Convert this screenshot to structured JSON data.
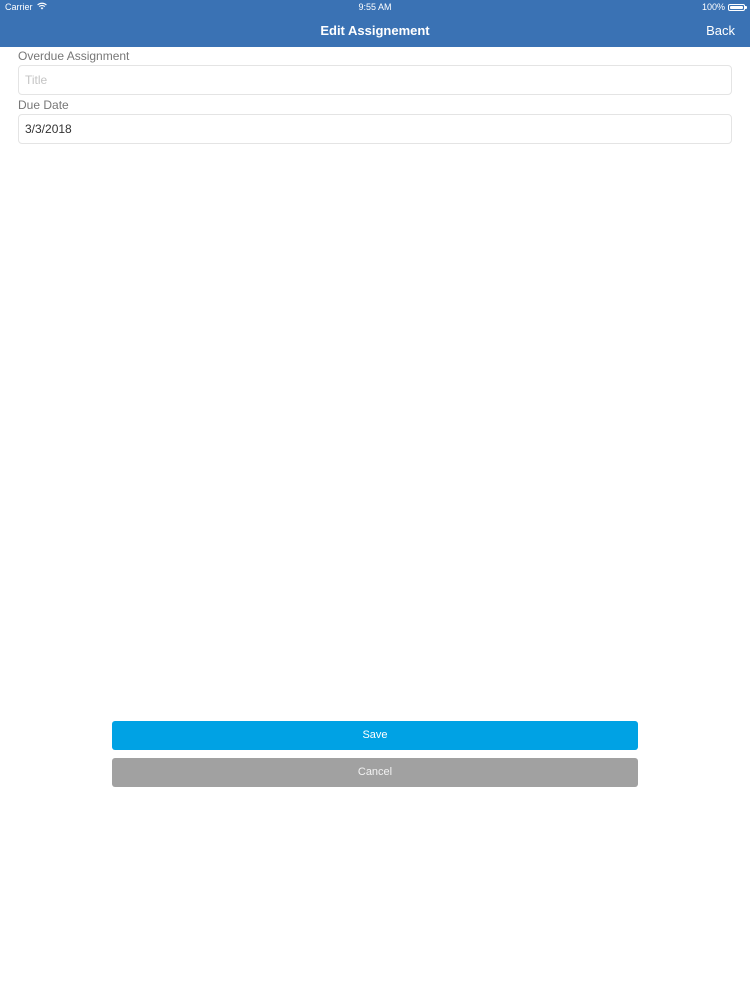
{
  "status_bar": {
    "carrier": "Carrier",
    "time": "9:55 AM",
    "battery": "100%",
    "battery_level": 1.0,
    "wifi_icon": "wifi-icon",
    "battery_icon": "battery-icon"
  },
  "nav": {
    "title": "Edit Assignement",
    "back_label": "Back"
  },
  "form": {
    "title_label": "Overdue Assignment",
    "title_value": "",
    "title_placeholder": "Title",
    "due_label": "Due Date",
    "due_value": "3/3/2018"
  },
  "actions": {
    "save_label": "Save",
    "cancel_label": "Cancel"
  },
  "colors": {
    "nav_background": "#3a72b4",
    "save_button": "#00a2e4",
    "cancel_button": "#a1a1a1"
  }
}
